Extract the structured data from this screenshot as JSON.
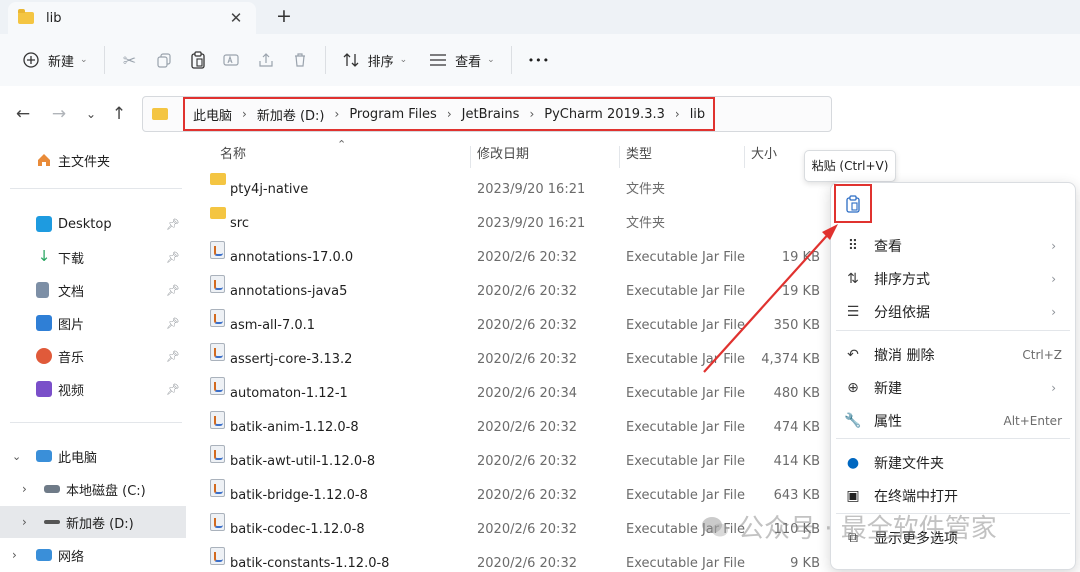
{
  "tab": {
    "title": "lib",
    "close": "✕",
    "new_tab": "+"
  },
  "toolbar": {
    "new_label": "新建",
    "sort_label": "排序",
    "view_label": "查看",
    "more": "•••"
  },
  "address": {
    "crumbs": [
      "此电脑",
      "新加卷 (D:)",
      "Program Files",
      "JetBrains",
      "PyCharm 2019.3.3",
      "lib"
    ]
  },
  "sidebar": {
    "home": "主文件夹",
    "quick": [
      {
        "label": "Desktop",
        "icon": "desktop-icon",
        "color": "#1e9be0"
      },
      {
        "label": "下载",
        "icon": "download-icon",
        "color": "#25a55f"
      },
      {
        "label": "文档",
        "icon": "document-icon",
        "color": "#7d8fa6"
      },
      {
        "label": "图片",
        "icon": "pictures-icon",
        "color": "#2f7fd6"
      },
      {
        "label": "音乐",
        "icon": "music-icon",
        "color": "#e05a3a"
      },
      {
        "label": "视频",
        "icon": "video-icon",
        "color": "#7a4fc9"
      }
    ],
    "this_pc": "此电脑",
    "drives": [
      {
        "label": "本地磁盘 (C:)",
        "selected": false
      },
      {
        "label": "新加卷 (D:)",
        "selected": true
      }
    ],
    "network": "网络"
  },
  "columns": {
    "name": "名称",
    "modified": "修改日期",
    "type": "类型",
    "size": "大小"
  },
  "files": [
    {
      "name": "pty4j-native",
      "modified": "2023/9/20 16:21",
      "type": "文件夹",
      "size": "",
      "kind": "folder"
    },
    {
      "name": "src",
      "modified": "2023/9/20 16:21",
      "type": "文件夹",
      "size": "",
      "kind": "folder"
    },
    {
      "name": "annotations-17.0.0",
      "modified": "2020/2/6 20:32",
      "type": "Executable Jar File",
      "size": "19 KB",
      "kind": "jar"
    },
    {
      "name": "annotations-java5",
      "modified": "2020/2/6 20:32",
      "type": "Executable Jar File",
      "size": "19 KB",
      "kind": "jar"
    },
    {
      "name": "asm-all-7.0.1",
      "modified": "2020/2/6 20:32",
      "type": "Executable Jar File",
      "size": "350 KB",
      "kind": "jar"
    },
    {
      "name": "assertj-core-3.13.2",
      "modified": "2020/2/6 20:32",
      "type": "Executable Jar File",
      "size": "4,374 KB",
      "kind": "jar"
    },
    {
      "name": "automaton-1.12-1",
      "modified": "2020/2/6 20:34",
      "type": "Executable Jar File",
      "size": "480 KB",
      "kind": "jar"
    },
    {
      "name": "batik-anim-1.12.0-8",
      "modified": "2020/2/6 20:32",
      "type": "Executable Jar File",
      "size": "474 KB",
      "kind": "jar"
    },
    {
      "name": "batik-awt-util-1.12.0-8",
      "modified": "2020/2/6 20:32",
      "type": "Executable Jar File",
      "size": "414 KB",
      "kind": "jar"
    },
    {
      "name": "batik-bridge-1.12.0-8",
      "modified": "2020/2/6 20:32",
      "type": "Executable Jar File",
      "size": "643 KB",
      "kind": "jar"
    },
    {
      "name": "batik-codec-1.12.0-8",
      "modified": "2020/2/6 20:32",
      "type": "Executable Jar File",
      "size": "110 KB",
      "kind": "jar"
    },
    {
      "name": "batik-constants-1.12.0-8",
      "modified": "2020/2/6 20:32",
      "type": "Executable Jar File",
      "size": "9 KB",
      "kind": "jar"
    }
  ],
  "context_menu": {
    "tooltip": "粘贴 (Ctrl+V)",
    "items": [
      {
        "label": "查看",
        "icon": "⠿",
        "shortcut": "",
        "submenu": true
      },
      {
        "label": "排序方式",
        "icon": "⇅",
        "shortcut": "",
        "submenu": true
      },
      {
        "label": "分组依据",
        "icon": "☰",
        "shortcut": "",
        "submenu": true
      },
      {
        "label": "撤消 删除",
        "icon": "↶",
        "shortcut": "Ctrl+Z",
        "submenu": false
      },
      {
        "label": "新建",
        "icon": "⊕",
        "shortcut": "",
        "submenu": true
      },
      {
        "label": "属性",
        "icon": "🔧",
        "shortcut": "Alt+Enter",
        "submenu": false
      },
      {
        "label": "新建文件夹",
        "icon": "●",
        "shortcut": "",
        "submenu": false
      },
      {
        "label": "在终端中打开",
        "icon": "▣",
        "shortcut": "",
        "submenu": false
      },
      {
        "label": "显示更多选项",
        "icon": "⧉",
        "shortcut": "",
        "submenu": false
      }
    ]
  },
  "watermark": "公众号 · 最全软件管家",
  "colors": {
    "highlight": "#e0322f",
    "folder": "#f4c542",
    "accent": "#0067c0"
  }
}
